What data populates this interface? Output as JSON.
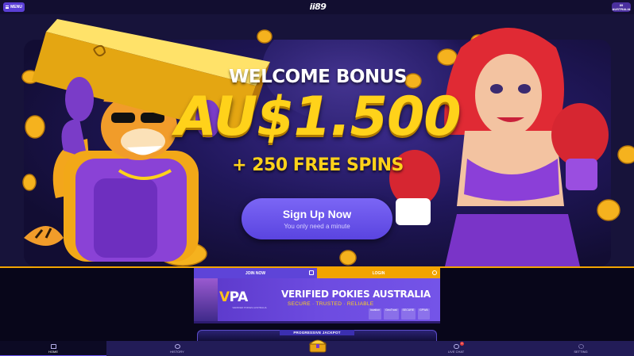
{
  "topbar": {
    "menu_label": "MENU",
    "logo_text": "ii89",
    "badge_line1": "89",
    "badge_line2": "AUSTRALIA"
  },
  "hero": {
    "welcome_text": "WELCOME BONUS",
    "amount_text": "AU$1.500",
    "spins_text": "+ 250 FREE SPINS",
    "signup_title": "Sign Up Now",
    "signup_subtitle": "You only need a minute"
  },
  "auth_tabs": {
    "join_label": "JOIN NOW",
    "login_label": "LOGIN"
  },
  "vpa_banner": {
    "logo_text": "VPA",
    "logo_sub": "VERIFIED POKIES AUSTRALIA",
    "title": "VERIFIED POKIES AUSTRALIA",
    "tagline": "SECURE · TRUSTED · RELIABLE",
    "partners": [
      "iovation",
      "GeoTrust",
      "SECURE",
      "GPWA"
    ]
  },
  "jackpot": {
    "label": "PROGRESSIVE JACKPOT"
  },
  "bottom_nav": {
    "home": "HOME",
    "history": "HISTORY",
    "live_chat": "LIVE CHAT",
    "live_chat_badge": "1",
    "setting": "SETTING"
  },
  "colors": {
    "accent_purple": "#5e44d8",
    "accent_gold": "#ffd21a",
    "login_orange": "#f2a400",
    "background": "#0c0a24"
  }
}
